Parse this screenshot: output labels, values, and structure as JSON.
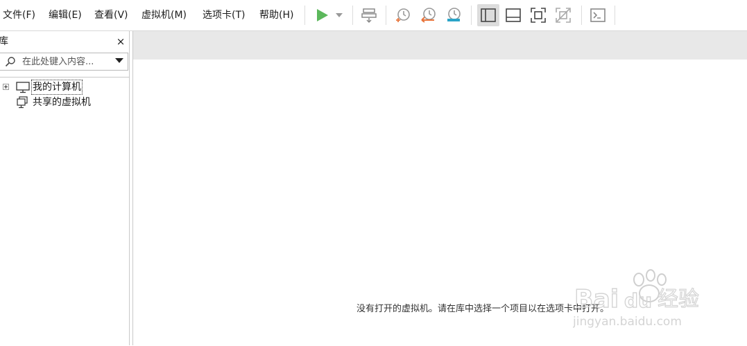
{
  "menu": {
    "file": "文件(F)",
    "edit": "编辑(E)",
    "view": "查看(V)",
    "vm": "虚拟机(M)",
    "tabs": "选项卡(T)",
    "help": "帮助(H)"
  },
  "toolbar": {
    "icons": [
      "play-icon",
      "dropdown-arrow-icon",
      "send-keys-icon",
      "snapshot-take-icon",
      "snapshot-revert-icon",
      "snapshot-manager-icon",
      "show-library-icon",
      "show-thumbnail-icon",
      "fullscreen-icon",
      "unity-icon",
      "console-icon"
    ],
    "colors": {
      "play": "#5cb85c",
      "snapshot_revert": "#e8743b",
      "snapshot_manager": "#2aa4c8"
    }
  },
  "sidebar": {
    "title": "库",
    "close": "×",
    "search_placeholder": "在此处键入内容...",
    "tree": [
      {
        "label": "我的计算机",
        "icon": "monitor-icon"
      },
      {
        "label": "共享的虚拟机",
        "icon": "shared-vm-icon"
      }
    ]
  },
  "main": {
    "empty_message": "没有打开的虚拟机。请在库中选择一个项目以在选项卡中打开。"
  },
  "watermark": {
    "brand": "Baidu经验",
    "url": "jingyan.baidu.com"
  }
}
